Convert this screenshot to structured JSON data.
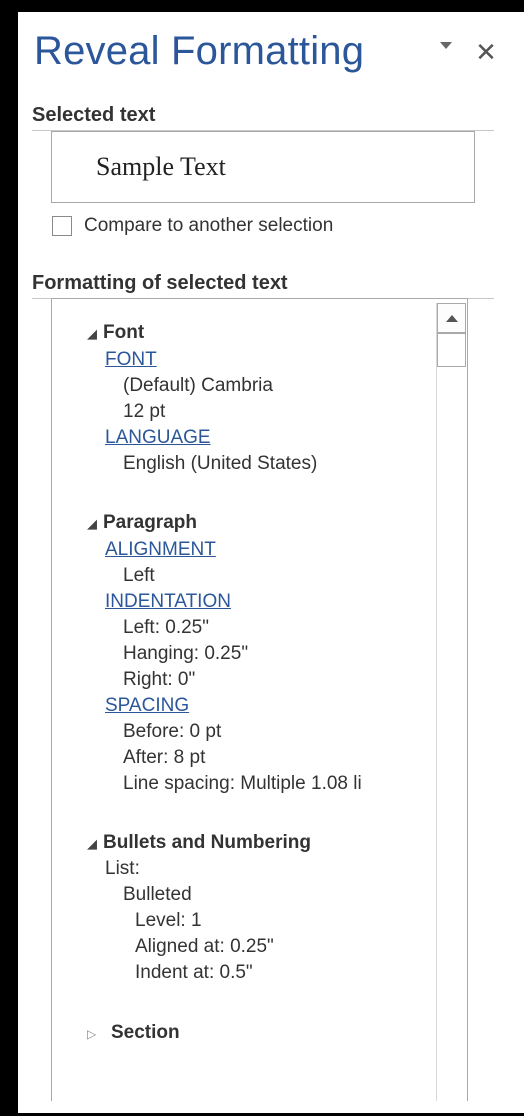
{
  "pane": {
    "title": "Reveal Formatting",
    "close_label": "✕"
  },
  "selected_text": {
    "header": "Selected text",
    "sample": "Sample Text",
    "compare_label": "Compare to another selection"
  },
  "formatting": {
    "header": "Formatting of selected text",
    "font": {
      "title": "Font",
      "font_link": "FONT",
      "font_name": "(Default) Cambria",
      "font_size": "12 pt",
      "language_link": "LANGUAGE",
      "language": "English (United States)"
    },
    "paragraph": {
      "title": "Paragraph",
      "alignment_link": "ALIGNMENT",
      "alignment": "Left",
      "indentation_link": "INDENTATION",
      "indent_left": "Left:  0.25\"",
      "indent_hanging": "Hanging:  0.25\"",
      "indent_right": "Right:  0\"",
      "spacing_link": "SPACING",
      "spacing_before": "Before:  0 pt",
      "spacing_after": "After:  8 pt",
      "line_spacing": "Line spacing:  Multiple 1.08 li"
    },
    "bullets": {
      "title": "Bullets and Numbering",
      "list_label": "List:",
      "list_type": "Bulleted",
      "level": "Level: 1",
      "aligned_at": "Aligned at:  0.25\"",
      "indent_at": "Indent at:  0.5\""
    },
    "section": {
      "title": "Section"
    }
  },
  "icons": {
    "expanded_arrow": "expanded-triangle-icon",
    "collapsed_arrow": "collapsed-triangle-icon"
  }
}
